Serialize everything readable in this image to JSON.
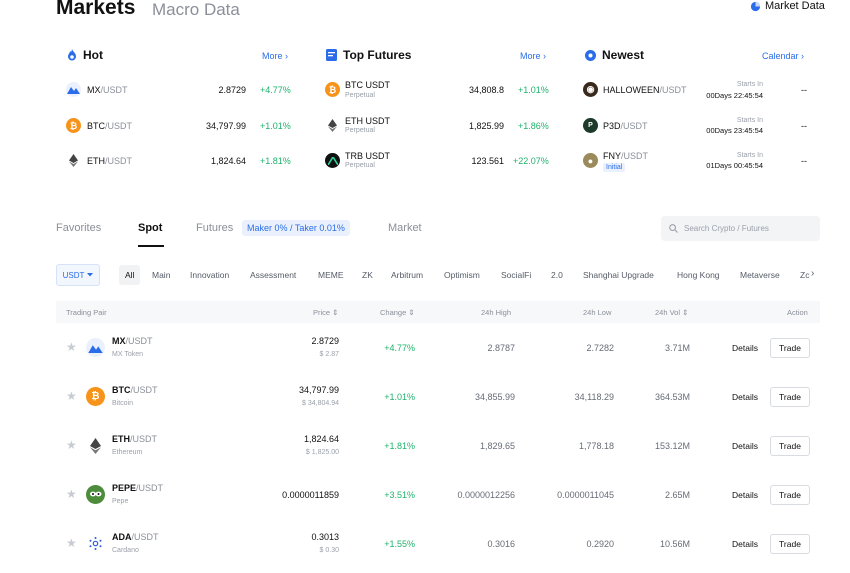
{
  "header": {
    "title": "Markets",
    "subtitle": "Macro Data",
    "market_data": "Market Data"
  },
  "hot": {
    "title": "Hot",
    "more": "More",
    "items": [
      {
        "base": "MX",
        "quote": "/USDT",
        "price": "2.8729",
        "change": "+4.77%"
      },
      {
        "base": "BTC",
        "quote": "/USDT",
        "price": "34,797.99",
        "change": "+1.01%"
      },
      {
        "base": "ETH",
        "quote": "/USDT",
        "price": "1,824.64",
        "change": "+1.81%"
      }
    ]
  },
  "futures": {
    "title": "Top Futures",
    "more": "More",
    "items": [
      {
        "symbol": "BTC USDT",
        "type": "Perpetual",
        "price": "34,808.8",
        "change": "+1.01%"
      },
      {
        "symbol": "ETH USDT",
        "type": "Perpetual",
        "price": "1,825.99",
        "change": "+1.86%"
      },
      {
        "symbol": "TRB USDT",
        "type": "Perpetual",
        "price": "123.561",
        "change": "+22.07%"
      }
    ]
  },
  "newest": {
    "title": "Newest",
    "calendar": "Calendar",
    "items": [
      {
        "base": "HALLOWEEN",
        "quote": "/USDT",
        "starts": "Starts In",
        "countdown": "00Days 22:45:54",
        "value": "--"
      },
      {
        "base": "P3D",
        "quote": "/USDT",
        "starts": "Starts In",
        "countdown": "00Days 23:45:54",
        "value": "--"
      },
      {
        "base": "FNY",
        "quote": "/USDT",
        "badge": "Initial",
        "starts": "Starts In",
        "countdown": "01Days 00:45:54",
        "value": "--"
      }
    ]
  },
  "tabs": {
    "favorites": "Favorites",
    "spot": "Spot",
    "futures": "Futures",
    "fee": "Maker 0% / Taker 0.01%",
    "market": "Market"
  },
  "search": {
    "placeholder": "Search Crypto / Futures"
  },
  "filters": {
    "quote": "USDT",
    "chips": [
      "All",
      "Main",
      "Innovation",
      "Assessment",
      "MEME",
      "ZK",
      "Arbitrum",
      "Optimism",
      "SocialFi",
      "2.0",
      "Shanghai Upgrade",
      "Hong Kong",
      "Metaverse",
      "Zc"
    ]
  },
  "table": {
    "headers": {
      "pair": "Trading Pair",
      "price": "Price",
      "change": "Change",
      "high": "24h High",
      "low": "24h Low",
      "vol": "24h Vol",
      "action": "Action"
    },
    "details": "Details",
    "trade": "Trade",
    "rows": [
      {
        "base": "MX",
        "quote": "/USDT",
        "name": "MX Token",
        "price": "2.8729",
        "price_usd": "$ 2.87",
        "change": "+4.77%",
        "high": "2.8787",
        "low": "2.7282",
        "vol": "3.71M"
      },
      {
        "base": "BTC",
        "quote": "/USDT",
        "name": "Bitcoin",
        "price": "34,797.99",
        "price_usd": "$ 34,804.94",
        "change": "+1.01%",
        "high": "34,855.99",
        "low": "34,118.29",
        "vol": "364.53M"
      },
      {
        "base": "ETH",
        "quote": "/USDT",
        "name": "Ethereum",
        "price": "1,824.64",
        "price_usd": "$ 1,825.00",
        "change": "+1.81%",
        "high": "1,829.65",
        "low": "1,778.18",
        "vol": "153.12M"
      },
      {
        "base": "PEPE",
        "quote": "/USDT",
        "name": "Pepe",
        "price": "0.0000011859",
        "price_usd": "",
        "change": "+3.51%",
        "high": "0.0000012256",
        "low": "0.0000011045",
        "vol": "2.65M"
      },
      {
        "base": "ADA",
        "quote": "/USDT",
        "name": "Cardano",
        "price": "0.3013",
        "price_usd": "$ 0.30",
        "change": "+1.55%",
        "high": "0.3016",
        "low": "0.2920",
        "vol": "10.56M"
      }
    ]
  },
  "colors": {
    "accent": "#2b6de8",
    "up": "#20b26c",
    "btc": "#f7931a",
    "mx": "#2b6de8"
  }
}
